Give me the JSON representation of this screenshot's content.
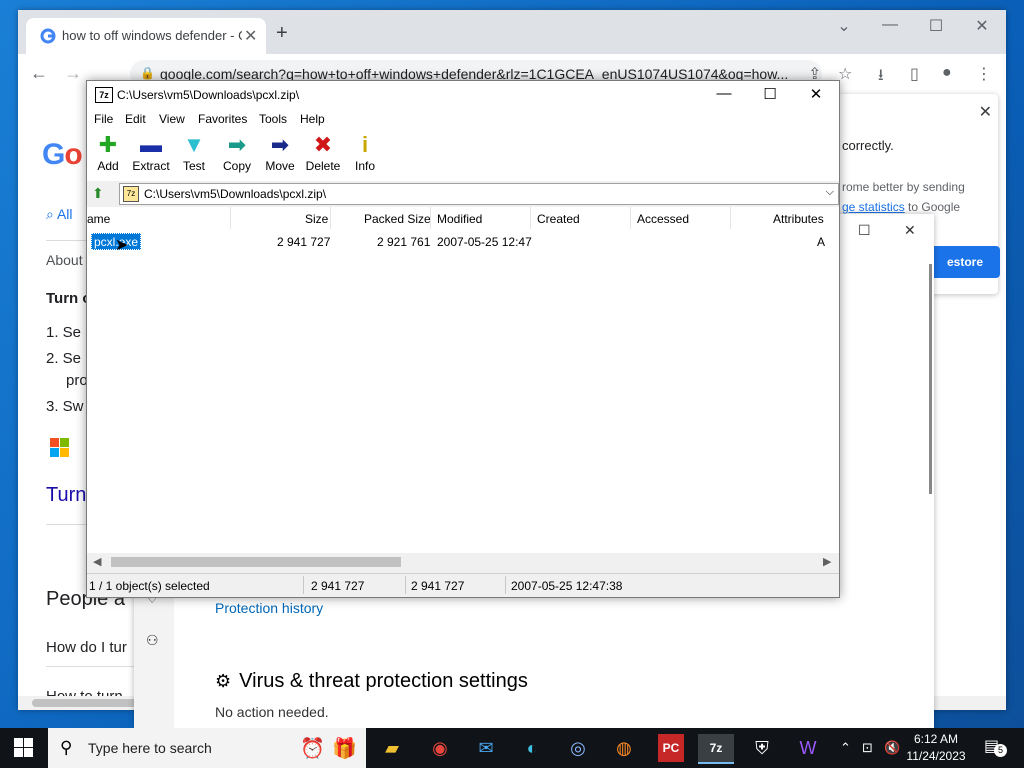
{
  "chrome": {
    "tab_title": "how to off windows defender - Google Search",
    "url": "google.com/search?q=how+to+off+windows+defender&rlz=1C1GCEA_enUS1074US1074&oq=how...",
    "google_snippets": {
      "all_tab": "All",
      "about": "About",
      "turn_heading": "Turn o",
      "step1": "1. Se",
      "step2": "2. Se",
      "step2b": "pro",
      "step3": "3. Sw",
      "turn_link": "Turn",
      "people_also": "People a",
      "q1": "How do I tur",
      "q2": "How to turn"
    },
    "popup": {
      "line1": "correctly.",
      "line2": "rome better by sending",
      "line3_link": "ge statistics",
      "line3_rest": " to Google",
      "button": "estore"
    }
  },
  "security": {
    "protection_history": "Protection history",
    "settings_heading": "Virus & threat protection settings",
    "settings_status": "No action needed."
  },
  "sevenzip": {
    "app_icon": "7z",
    "title": "C:\\Users\\vm5\\Downloads\\pcxl.zip\\",
    "menu": [
      "File",
      "Edit",
      "View",
      "Favorites",
      "Tools",
      "Help"
    ],
    "toolbar": [
      {
        "label": "Add",
        "icon": "add-icon",
        "glyph": "✚",
        "color": "#22a722"
      },
      {
        "label": "Extract",
        "icon": "extract-icon",
        "glyph": "▬",
        "color": "#1a2ea8"
      },
      {
        "label": "Test",
        "icon": "test-icon",
        "glyph": "▼",
        "color": "#2bbfd0"
      },
      {
        "label": "Copy",
        "icon": "copy-icon",
        "glyph": "➡",
        "color": "#1a9a8a"
      },
      {
        "label": "Move",
        "icon": "move-icon",
        "glyph": "➡",
        "color": "#1a2a8a"
      },
      {
        "label": "Delete",
        "icon": "delete-icon",
        "glyph": "✖",
        "color": "#d01818"
      },
      {
        "label": "Info",
        "icon": "info-icon",
        "glyph": "i",
        "color": "#c8a800"
      }
    ],
    "address": "C:\\Users\\vm5\\Downloads\\pcxl.zip\\",
    "columns": [
      "ame",
      "Size",
      "Packed Size",
      "Modified",
      "Created",
      "Accessed",
      "Attributes"
    ],
    "rows": [
      {
        "name": "pcxl.exe",
        "size": "2 941 727",
        "packed": "2 921 761",
        "modified": "2007-05-25 12:47",
        "created": "",
        "accessed": "",
        "attributes": "A"
      }
    ],
    "status": {
      "selected": "1 / 1 object(s) selected",
      "size": "2 941 727",
      "packed": "2 941 727",
      "modified": "2007-05-25 12:47:38"
    }
  },
  "taskbar": {
    "search_placeholder": "Type here to search",
    "time": "6:12 AM",
    "date": "11/24/2023",
    "notifications": "5"
  }
}
